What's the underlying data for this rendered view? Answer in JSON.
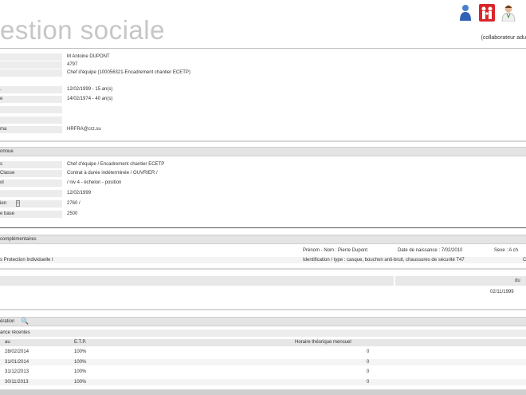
{
  "header": {
    "app_title": "estion sociale",
    "user_label": "(collaborateur adu",
    "icons": [
      "person-blue-icon",
      "family-red-icon",
      "doctor-icon"
    ]
  },
  "identity": {
    "rows": [
      {
        "label": "",
        "value": "M Antoine DUPONT"
      },
      {
        "label": "",
        "value": "4797"
      },
      {
        "label": "",
        "value": "Chef d'équipe (100056321-Encadrement chantier ECETP)"
      },
      {
        "label": ".",
        "value": "12/02/1999 - 15 an(s)"
      },
      {
        "label": "e",
        "value": "14/02/1974 - 40 an(s)"
      },
      {
        "label": "",
        "value": ""
      },
      {
        "label": "",
        "value": ""
      },
      {
        "label": "ma",
        "value": "HRFRA@crz.su"
      }
    ]
  },
  "contract": {
    "title": "onnue",
    "rows": [
      {
        "label": "s",
        "value": "Chef d'équipe / Encadrement chantier ECETP"
      },
      {
        "label": "Classe",
        "value": "Contrat à durée indéterminée / OUVRIER /"
      },
      {
        "label": "ol",
        "value": "/ niv 4 - échelon - position"
      },
      {
        "label": "",
        "value": "12/02/1999"
      },
      {
        "label": "ien",
        "value": "2760 /"
      },
      {
        "label": "e base",
        "value": "2500"
      }
    ]
  },
  "complementary": {
    "title": "complémentaires",
    "row1": {
      "name": "Prénom - Nom : Pierre Dupont",
      "birth": "Date de naissance : 7/02/2010",
      "sex": "Sexe : A ch"
    },
    "row2": {
      "left": "s Protection Individuelle I",
      "right": "Identification / type : casque, bouchon anti-bruit, chaussures de sécurité T47",
      "tail": "C"
    }
  },
  "period": {
    "col_right": "du",
    "value": "02/11/1999"
  },
  "schedule": {
    "title": "ération",
    "subtitle": "ance récentes",
    "columns": [
      "au",
      "E.T.P.",
      "Horaire théorique mensuel"
    ],
    "rows": [
      {
        "date": "28/02/2014",
        "etp": "100%",
        "hours": "0"
      },
      {
        "date": "31/01/2014",
        "etp": "100%",
        "hours": "0"
      },
      {
        "date": "31/12/2013",
        "etp": "100%",
        "hours": "0"
      },
      {
        "date": "30/11/2013",
        "etp": "100%",
        "hours": "0"
      }
    ]
  }
}
